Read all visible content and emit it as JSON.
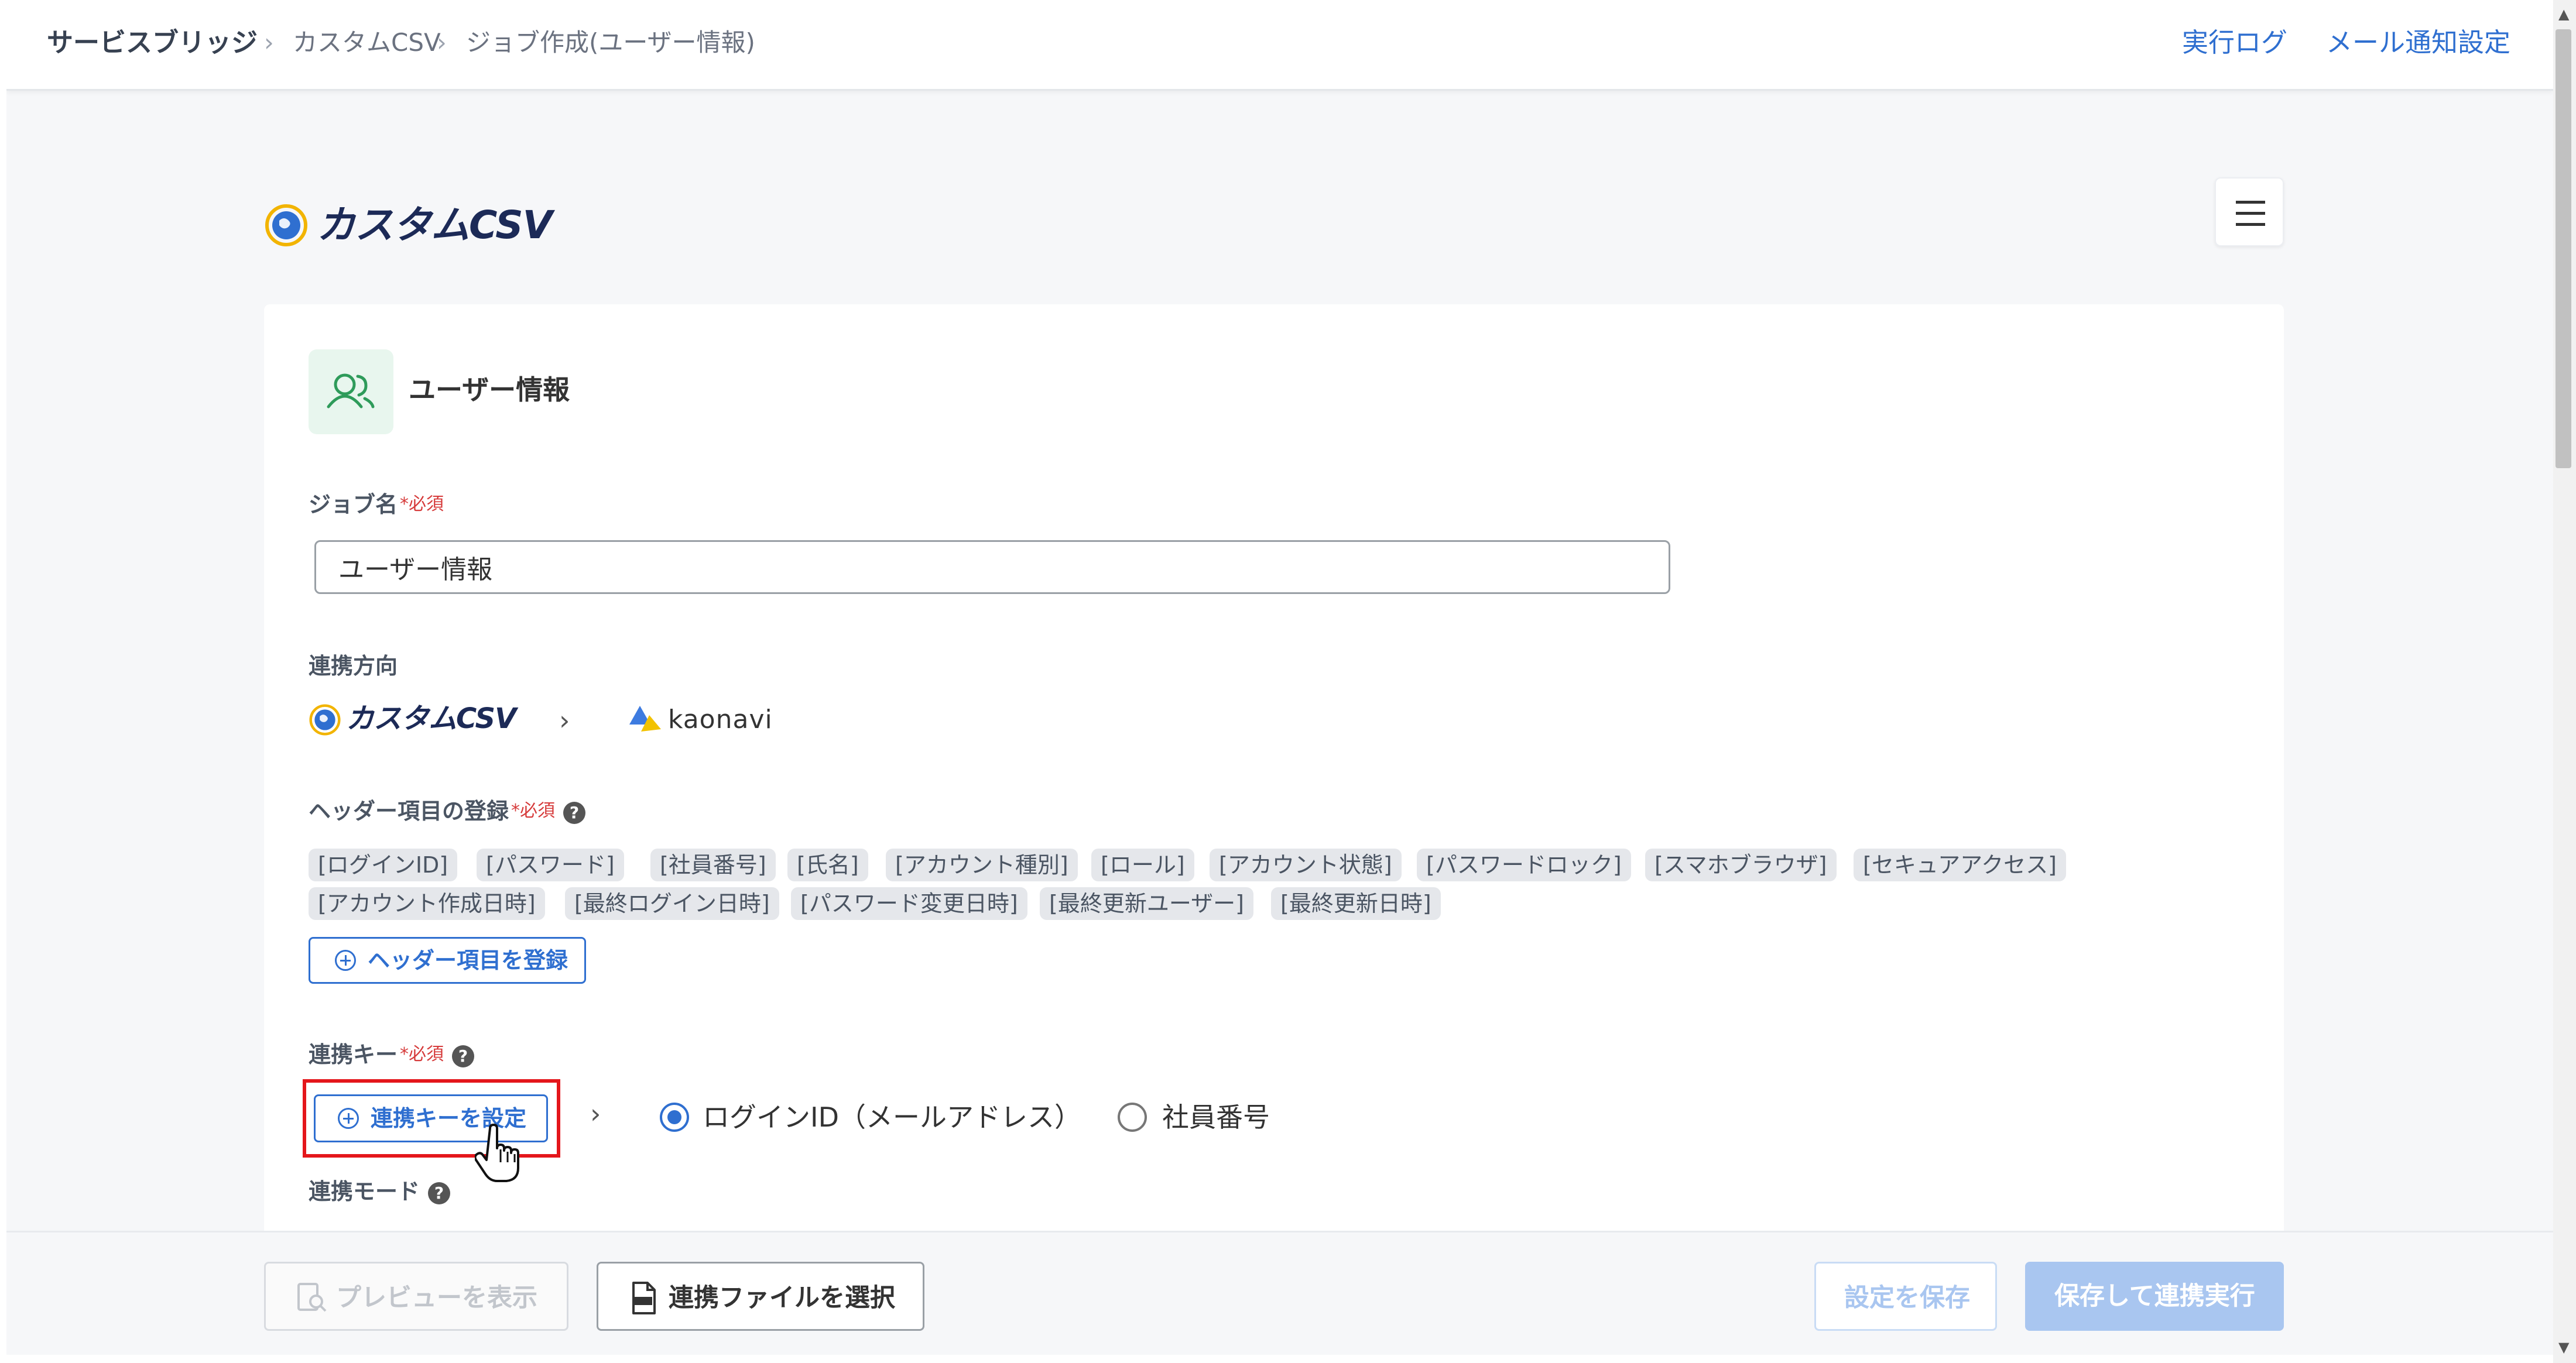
{
  "breadcrumb": {
    "home": "サービスブリッジ",
    "parent": "カスタムCSV",
    "current": "ジョブ作成(ユーザー情報)"
  },
  "top_links": {
    "exec_log": "実行ログ",
    "mail_settings": "メール通知設定"
  },
  "app_logo": "カスタムCSV",
  "section": {
    "title": "ユーザー情報",
    "icon": "users-icon"
  },
  "job_name": {
    "label": "ジョブ名",
    "required_mark": "*",
    "required_text": "必須",
    "value": "ユーザー情報"
  },
  "direction": {
    "label": "連携方向",
    "source": "カスタムCSV",
    "target": "kaonavi"
  },
  "headers": {
    "label": "ヘッダー項目の登録",
    "required_mark": "*",
    "required_text": "必須",
    "help": "?",
    "chips": [
      "[ログインID]",
      "[パスワード]",
      "[社員番号]",
      "[氏名]",
      "[アカウント種別]",
      "[ロール]",
      "[アカウント状態]",
      "[パスワードロック]",
      "[スマホブラウザ]",
      "[セキュアアクセス]",
      "[アカウント作成日時]",
      "[最終ログイン日時]",
      "[パスワード変更日時]",
      "[最終更新ユーザー]",
      "[最終更新日時]"
    ],
    "register_button": "ヘッダー項目を登録"
  },
  "link_key": {
    "label": "連携キー",
    "required_mark": "*",
    "required_text": "必須",
    "help": "?",
    "set_button": "連携キーを設定",
    "options": [
      {
        "label": "ログインID（メールアドレス）",
        "selected": true
      },
      {
        "label": "社員番号",
        "selected": false
      }
    ]
  },
  "link_mode": {
    "label": "連携モード",
    "help": "?"
  },
  "footer": {
    "preview": "プレビューを表示",
    "select_file": "連携ファイルを選択",
    "save_settings": "設定を保存",
    "save_and_run": "保存して連携実行"
  },
  "colors": {
    "accent": "#2f6fd0",
    "required": "#d63b3b",
    "highlight": "#e4161b",
    "disabled_primary": "#a9c6f0"
  }
}
